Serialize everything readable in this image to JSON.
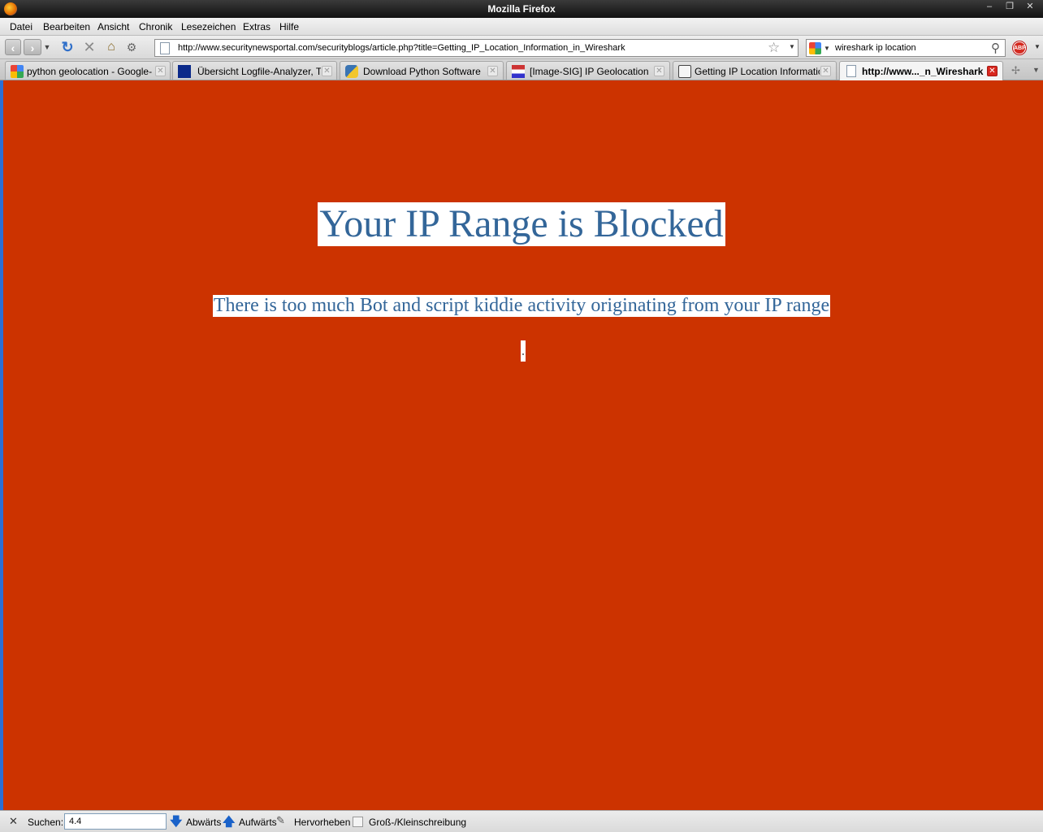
{
  "window": {
    "title": "Mozilla Firefox",
    "min_glyph": "–",
    "max_glyph": "❐",
    "close_glyph": "✕"
  },
  "menu": {
    "items": [
      "Datei",
      "Bearbeiten",
      "Ansicht",
      "Chronik",
      "Lesezeichen",
      "Extras",
      "Hilfe"
    ]
  },
  "navbar": {
    "url": "http://www.securitynewsportal.com/securityblogs/article.php?title=Getting_IP_Location_Information_in_Wireshark",
    "search_value": "wireshark ip location",
    "abp_label": "ABP"
  },
  "tabs": [
    {
      "label": "python geolocation - Google-S...",
      "icon": "google-icon"
    },
    {
      "label": "Übersicht Logfile-Analyzer, To...",
      "icon": "tool-icon"
    },
    {
      "label": "Download Python Software",
      "icon": "python-icon"
    },
    {
      "label": "[Image-SIG] IP Geolocation",
      "icon": "mailman-icon"
    },
    {
      "label": "Getting IP Location Information...",
      "icon": "feed-icon"
    },
    {
      "label": "http://www..._n_Wireshark",
      "icon": "page-icon",
      "active": true
    }
  ],
  "page": {
    "headline": "Your IP Range is Blocked",
    "message": "There is too much Bot and script kiddie activity originating from your IP range",
    "background_color": "#cc3300",
    "text_color": "#336699"
  },
  "findbar": {
    "label": "Suchen:",
    "value": "4.4",
    "next_label": "Abwärts",
    "prev_label": "Aufwärts",
    "highlight_label": "Hervorheben",
    "match_case_label": "Groß-/Kleinschreibung"
  }
}
